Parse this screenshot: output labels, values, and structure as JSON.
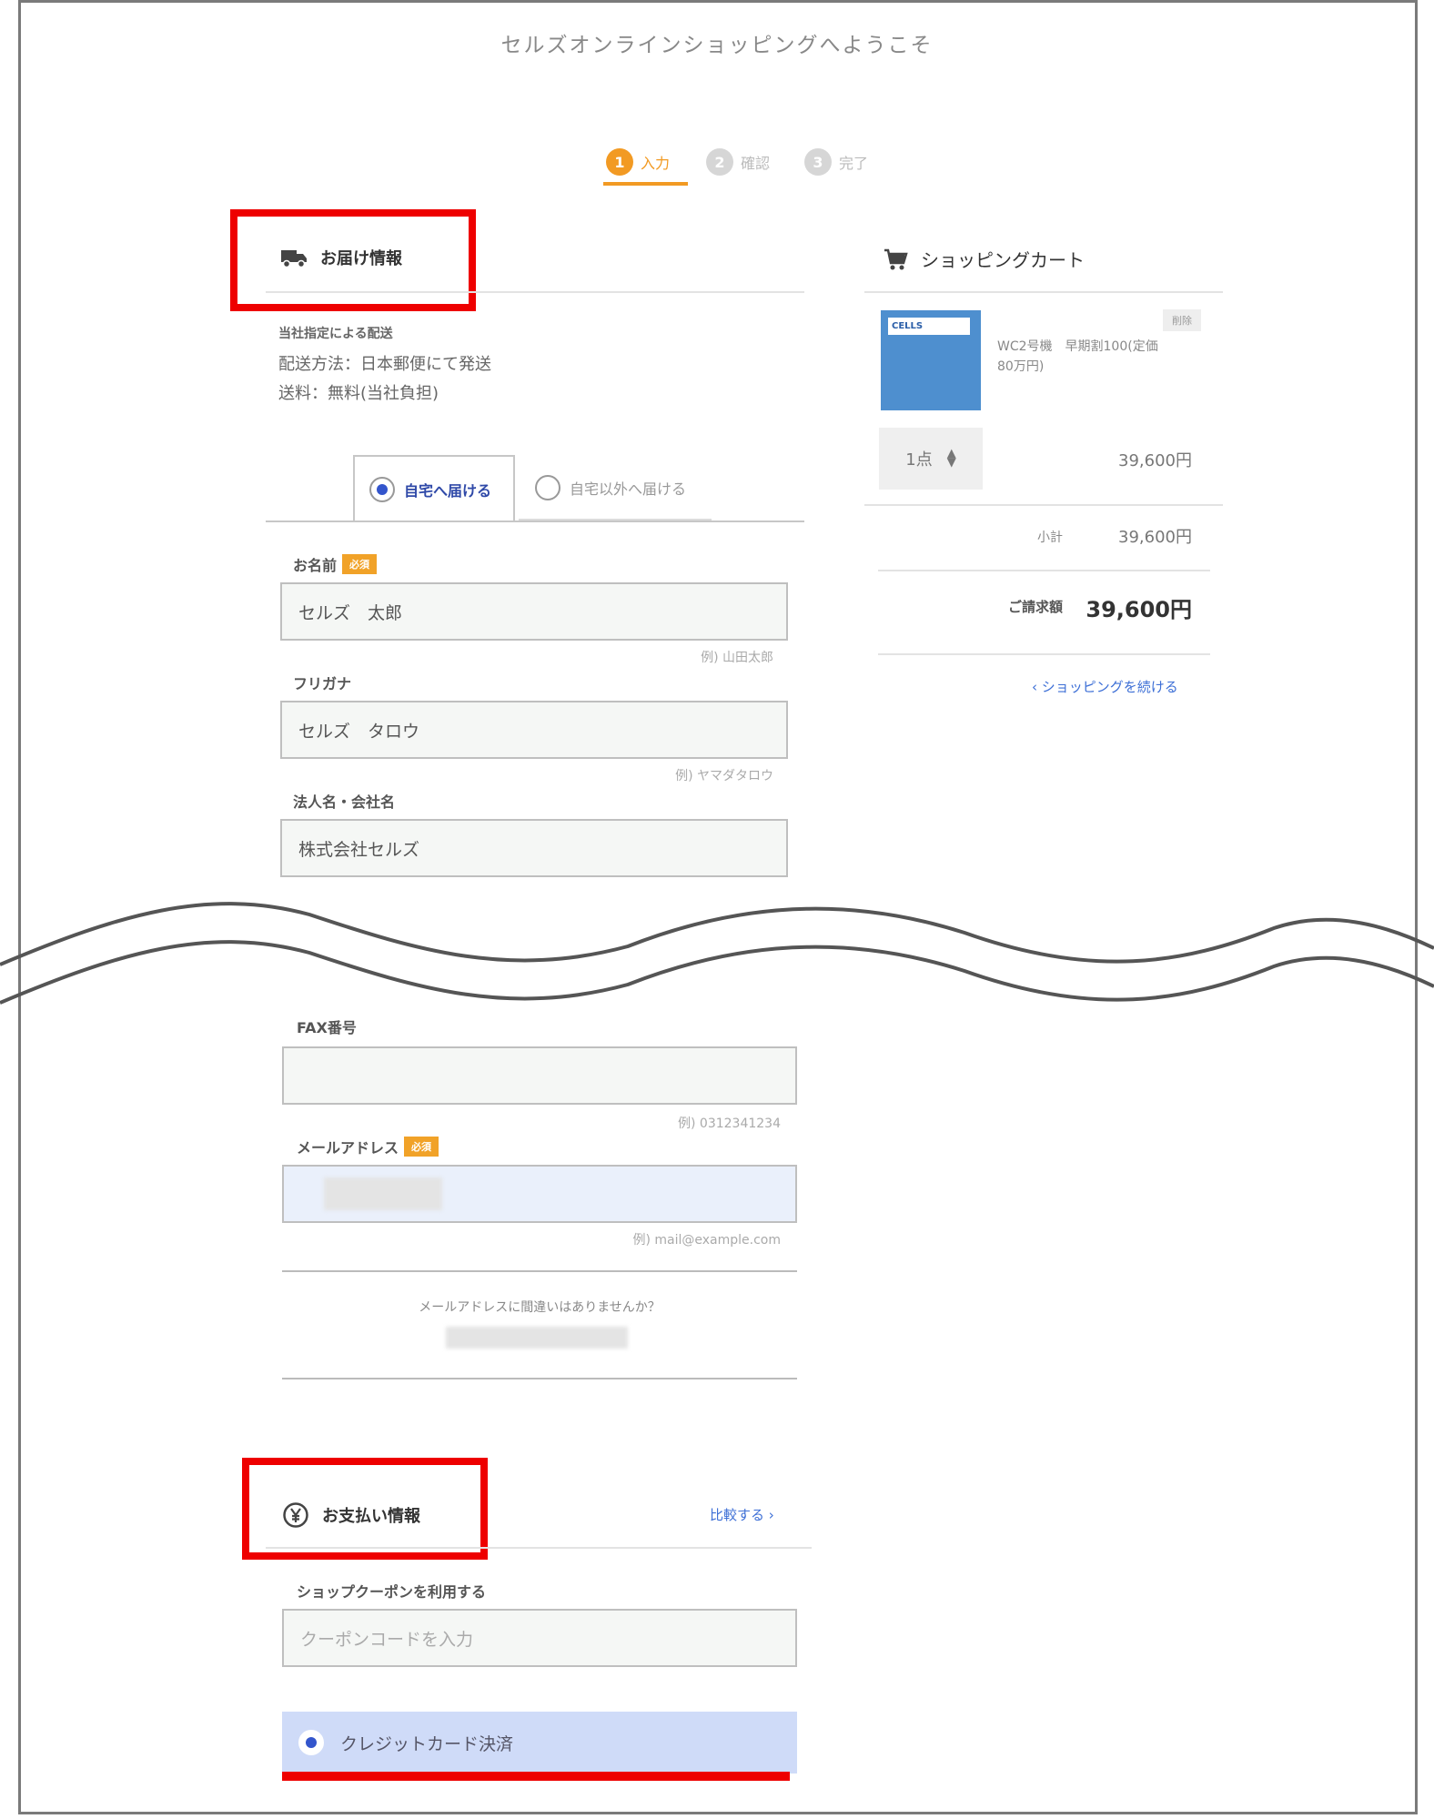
{
  "header": {
    "welcome": "セルズオンラインショッピングへようこそ"
  },
  "steps": [
    {
      "num": "1",
      "label": "入力",
      "active": true
    },
    {
      "num": "2",
      "label": "確認",
      "active": false
    },
    {
      "num": "3",
      "label": "完了",
      "active": false
    }
  ],
  "delivery": {
    "title": "お届け情報",
    "method_heading": "当社指定による配送",
    "method": "配送方法：日本郵便にて発送",
    "fee": "送料：無料(当社負担)",
    "tabs": {
      "home": "自宅へ届ける",
      "other": "自宅以外へ届ける"
    },
    "name": {
      "label": "お名前",
      "value": "セルズ　太郎",
      "hint": "例) 山田太郎"
    },
    "kana": {
      "label": "フリガナ",
      "value": "セルズ　タロウ",
      "hint": "例) ヤマダタロウ"
    },
    "company": {
      "label": "法人名・会社名",
      "value": "株式会社セルズ"
    },
    "required_badge": "必須",
    "fax": {
      "label": "FAX番号",
      "value": "",
      "hint": "例) 0312341234"
    },
    "email": {
      "label": "メールアドレス",
      "hint": "例) mail@example.com"
    },
    "email_confirm": "メールアドレスに間違いはありませんか？"
  },
  "cart": {
    "title": "ショッピングカート",
    "item": {
      "name": "WC2号機　早期割100(定価80万円)",
      "tag": "削除",
      "qty": "1点",
      "price": "39,600円"
    },
    "subtotal_label": "小計",
    "subtotal": "39,600円",
    "total_label": "ご請求額",
    "total": "39,600円",
    "continue": "ショッピングを続ける"
  },
  "payment": {
    "title": "お支払い情報",
    "compare": "比較する",
    "coupon_label": "ショップクーポンを利用する",
    "coupon_placeholder": "クーポンコードを入力",
    "credit": "クレジットカード決済"
  },
  "colors": {
    "accent": "#f29a23",
    "highlight": "#ee0000",
    "link": "#3d6fd6"
  }
}
